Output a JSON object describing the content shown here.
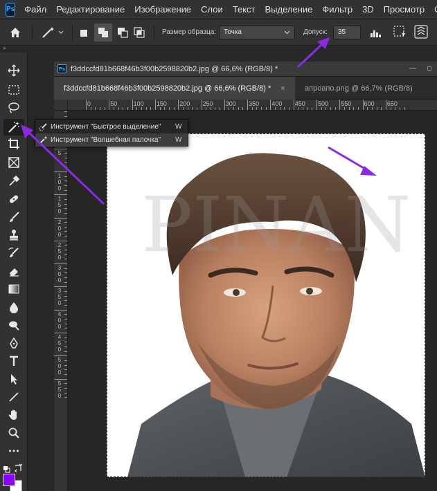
{
  "menu": {
    "logo": "Ps",
    "items": [
      "Файл",
      "Редактирование",
      "Изображение",
      "Слои",
      "Текст",
      "Выделение",
      "Фильтр",
      "3D",
      "Просмотр",
      "Окно"
    ]
  },
  "options": {
    "sample_size_label": "Размер образца:",
    "sample_size_value": "Точка",
    "tolerance_label": "Допуск:",
    "tolerance_value": "35"
  },
  "document": {
    "logo": "Ps",
    "title": "f3ddccfd81b668f46b3f00b2598820b2.jpg @ 66,6% (RGB/8) *",
    "tabs": [
      {
        "label": "f3ddccfd81b668f46b3f00b2598820b2.jpg @ 66,6% (RGB/8) *",
        "active": true,
        "close": "×"
      },
      {
        "label": "апроапо.png @ 66,7% (RGB/8)",
        "active": false
      }
    ],
    "ruler_h": [
      "0",
      "50",
      "100",
      "150",
      "200",
      "250",
      "300",
      "350",
      "400",
      "450",
      "500",
      "550",
      "600",
      "650"
    ],
    "ruler_v": [
      "5",
      "0",
      "5",
      "1\n0\n0",
      "1\n5\n0",
      "2\n0\n0",
      "2\n5\n0",
      "3\n0\n0",
      "3\n5\n0",
      "4\n0\n0",
      "4\n5\n0",
      "5\n0\n0",
      "5\n5\n0"
    ],
    "watermark": "PINAN"
  },
  "flyout": {
    "items": [
      {
        "label": "Инструмент \"Быстрое выделение\"",
        "key": "W"
      },
      {
        "label": "Инструмент \"Волшебная палочка\"",
        "key": "W"
      }
    ]
  },
  "colors": {
    "foreground": "#8a00ff",
    "background": "#ffffff",
    "annotation": "#8a2be2",
    "ps_blue": "#31a8ff"
  },
  "icons": {
    "home": "home-icon",
    "magic_wand": "magic-wand-icon"
  }
}
